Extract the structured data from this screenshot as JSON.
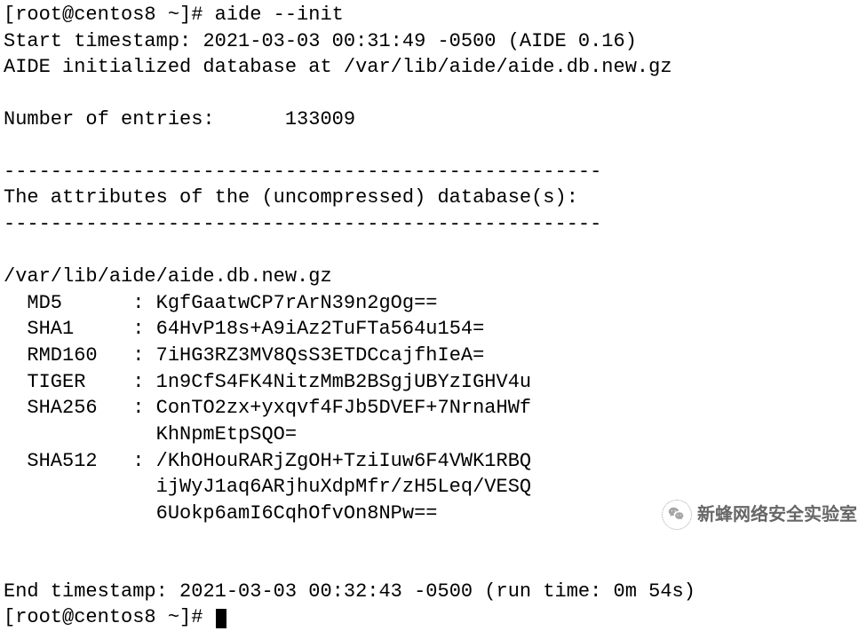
{
  "prompt1_user": "[root@centos8 ~]# ",
  "command1": "aide --init",
  "start_ts_label": "Start timestamp: ",
  "start_ts_value": "2021-03-03 00:31:49 -0500 (AIDE 0.16)",
  "init_msg": "AIDE initialized database at /var/lib/aide/aide.db.new.gz",
  "entries_label": "Number of entries:",
  "entries_value": "133009",
  "divider": "---------------------------------------------------",
  "attr_header": "The attributes of the (uncompressed) database(s):",
  "db_path": "/var/lib/aide/aide.db.new.gz",
  "hashes": {
    "md5": {
      "label": "  MD5      : ",
      "v1": "KgfGaatwCP7rArN39n2gOg=="
    },
    "sha1": {
      "label": "  SHA1     : ",
      "v1": "64HvP18s+A9iAz2TuFTa564u154="
    },
    "rmd160": {
      "label": "  RMD160   : ",
      "v1": "7iHG3RZ3MV8QsS3ETDCcajfhIeA="
    },
    "tiger": {
      "label": "  TIGER    : ",
      "v1": "1n9CfS4FK4NitzMmB2BSgjUBYzIGHV4u"
    },
    "sha256": {
      "label": "  SHA256   : ",
      "v1": "ConTO2zx+yxqvf4FJb5DVEF+7NrnaHWf",
      "v2": "             KhNpmEtpSQO="
    },
    "sha512": {
      "label": "  SHA512   : ",
      "v1": "/KhOHouRARjZgOH+TziIuw6F4VWK1RBQ",
      "v2": "             ijWyJ1aq6ARjhuXdpMfr/zH5Leq/VESQ",
      "v3": "             6Uokp6amI6CqhOfvOn8NPw=="
    }
  },
  "end_ts_label": "End timestamp: ",
  "end_ts_value": "2021-03-03 00:32:43 -0500 (run time: 0m 54s)",
  "prompt2": "[root@centos8 ~]# ",
  "watermark": "新蜂网络安全实验室"
}
